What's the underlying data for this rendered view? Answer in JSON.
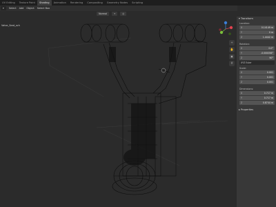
{
  "topbar": {
    "tabs": [
      {
        "label": "UV Editing",
        "active": false
      },
      {
        "label": "Texture Paint",
        "active": false
      },
      {
        "label": "Shading",
        "active": true
      },
      {
        "label": "Animation",
        "active": false
      },
      {
        "label": "Rendering",
        "active": false
      },
      {
        "label": "Compositing",
        "active": false
      },
      {
        "label": "Geometry Nodes",
        "active": false
      },
      {
        "label": "Scripting",
        "active": false
      }
    ]
  },
  "header": {
    "menu": [
      "Select",
      "Add",
      "Object"
    ],
    "select_box": "Select Box"
  },
  "viewport": {
    "object_name": "Valve_Seat_sch",
    "orientation": "Normal",
    "colors": {
      "bg": "#2b2b2b",
      "wire": "#0a0a0a",
      "gizmo_x": "#e0424f",
      "gizmo_y": "#7bbf3a",
      "gizmo_z": "#3b7fd6"
    }
  },
  "npanel": {
    "transform_title": "Transform",
    "location_label": "Location:",
    "location": [
      {
        "axis": "X",
        "value": "0.14149 m"
      },
      {
        "axis": "Y",
        "value": "0 m"
      },
      {
        "axis": "Z",
        "value": "1.4442 m"
      }
    ],
    "rotation_label": "Rotation:",
    "rotation": [
      {
        "axis": "X",
        "value": "0.0°"
      },
      {
        "axis": "Y",
        "value": "-0.000056°"
      },
      {
        "axis": "Z",
        "value": "90°"
      }
    ],
    "rotation_mode": "XYZ Euler",
    "scale_label": "Scale:",
    "scale": [
      {
        "axis": "X",
        "value": "0.001"
      },
      {
        "axis": "Y",
        "value": "0.001"
      },
      {
        "axis": "Z",
        "value": "0.001"
      }
    ],
    "dimensions_label": "Dimensions:",
    "dimensions": [
      {
        "axis": "X",
        "value": "0.717 m"
      },
      {
        "axis": "Y",
        "value": "0.717 m"
      },
      {
        "axis": "Z",
        "value": "0.8744 m"
      }
    ],
    "properties_title": "Properties"
  }
}
